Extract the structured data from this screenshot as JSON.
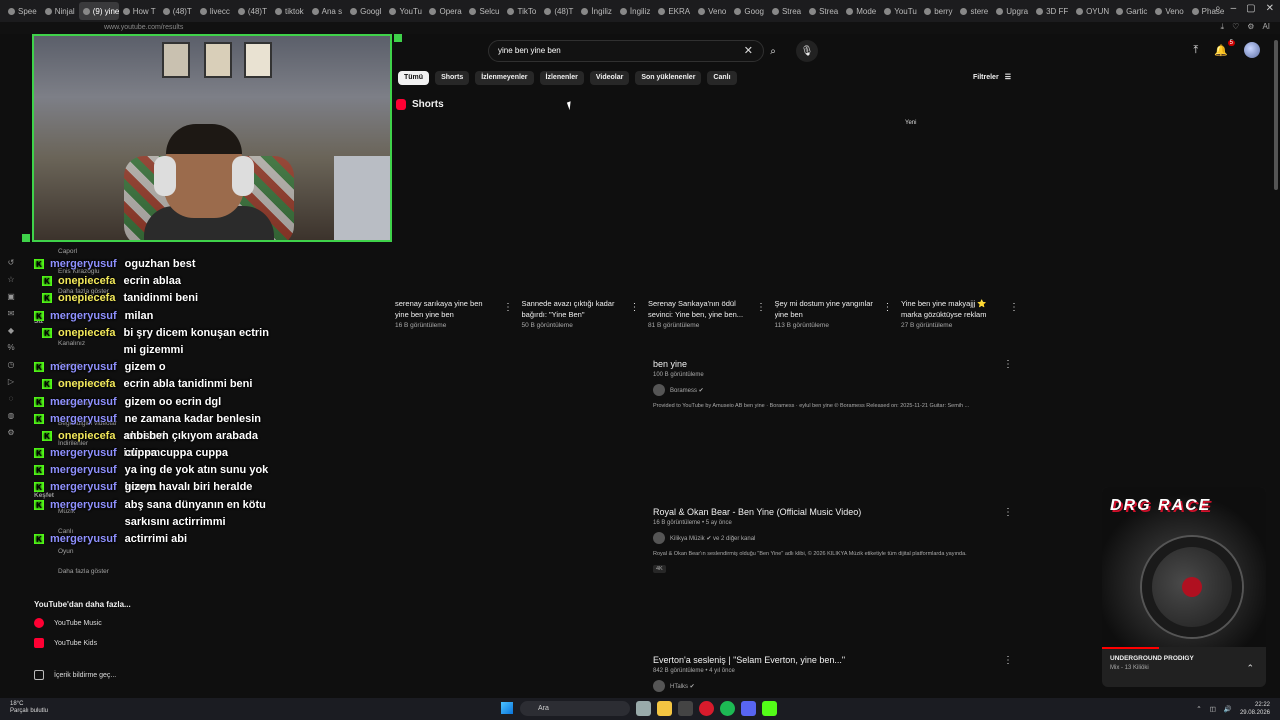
{
  "browser": {
    "tabs": [
      "Spee",
      "Ninjal",
      "(9) yine ben",
      "How T",
      "(48)T",
      "livecc",
      "(48)T",
      "tiktok",
      "Ana s",
      "Googl",
      "YouTu",
      "Opera",
      "Selcu",
      "TikTo",
      "(48)T",
      "İngiliz",
      "İngiliz",
      "EKRA",
      "Veno",
      "Goog",
      "Strea",
      "Strea",
      "Mode",
      "YouTu",
      "berry",
      "stere",
      "Upgra",
      "3D FF",
      "OYUN",
      "Gartic",
      "Veno",
      "Phase"
    ],
    "url": "www.youtube.com/results",
    "ai_label": "AI"
  },
  "search": {
    "query": "yine ben yine ben"
  },
  "chips": [
    "Tümü",
    "Shorts",
    "İzlenmeyenler",
    "İzlenenler",
    "Videolar",
    "Son yüklenenler",
    "Canlı"
  ],
  "filters_label": "Filtreler",
  "notifications_count": "5",
  "shorts": {
    "header": "Shorts",
    "new_label": "Yeni",
    "items": [
      {
        "title": "serenay sarıkaya yine ben yine ben yine ben",
        "views": "16 B görüntüleme"
      },
      {
        "title": "Sannede avazı çıktığı kadar bağırdı: \"Yine Ben\"",
        "views": "50 B görüntüleme"
      },
      {
        "title": "Serenay Sarıkaya'nın ödül sevinci: Yine ben, yine ben...",
        "views": "81 B görüntüleme"
      },
      {
        "title": "Şey mi dostum yine yangınlar yine ben",
        "views": "113 B görüntüleme"
      },
      {
        "title": "Yine ben yine makyajjj ⭐ marka gözüktüyse reklam",
        "views": "27 B görüntüleme"
      }
    ]
  },
  "videos": [
    {
      "title": "ben yine",
      "meta": "100 B görüntüleme",
      "channel": "Boramess ✔",
      "desc": "Provided to YouTube by Amuseio AB ben yine · Boramess · eylul ben yine ℗ Boramess Released on: 2025-11-21 Guitar: Semih ...",
      "tag": ""
    },
    {
      "title": "Royal & Okan Bear - Ben Yine (Official Music Video)",
      "meta": "16 B görüntüleme • 5 ay önce",
      "channel": "Kilikya Müzik ✔ ve 2 diğer kanal",
      "desc": "Royal & Okan Bear'ın seslendirmiş olduğu \"Ben Yine\" adlı klibi, © 2026 KİLİKYA Müzik etiketiyle tüm dijital platformlarda yayında.",
      "tag": "4K"
    },
    {
      "title": "Everton'a sesleniş | \"Selam Everton, yine ben...\"",
      "meta": "842 B görüntüleme • 4 yıl önce",
      "channel": "HTalks ✔",
      "desc": "",
      "tag": ""
    }
  ],
  "sidebar": {
    "ghost_items": [
      "Caporl",
      "Enis Kirazoglu",
      "Daha fazla göster",
      "Siz",
      "Kanalınız",
      "Geçmiş",
      "Oynatma listeleri",
      "Videolarınız",
      "Beğendiğim videolar",
      "İndirilenler",
      "Keşfet",
      "Müzik",
      "Canlı",
      "Oyun",
      "Daha fazla göster"
    ],
    "section_more": "YouTube'dan daha fazla...",
    "yt_music": "YouTube Music",
    "yt_kids": "YouTube Kids",
    "report": "İçerik bildirme geç..."
  },
  "chat": [
    {
      "user": "mergeryusuf",
      "text": "oguzhan best",
      "color": "#8f91ff"
    },
    {
      "user": "onepiecefa",
      "text": "ecrin ablaa",
      "color": "#f2e85a"
    },
    {
      "user": "onepiecefa",
      "text": "tanidinmi beni",
      "color": "#f2e85a"
    },
    {
      "user": "mergeryusuf",
      "text": "milan",
      "color": "#8f91ff"
    },
    {
      "user": "onepiecefa",
      "text": "bi şry dicem konuşan ectrin mi gizemmi",
      "color": "#f2e85a"
    },
    {
      "user": "mergeryusuf",
      "text": "gizem o",
      "color": "#8f91ff"
    },
    {
      "user": "onepiecefa",
      "text": "ecrin abla tanidinmi beni",
      "color": "#f2e85a"
    },
    {
      "user": "mergeryusuf",
      "text": "gizem oo ecrin dgl",
      "color": "#8f91ff"
    },
    {
      "user": "mergeryusuf",
      "text": "ne zamana kadar benlesin ekoshvl",
      "color": "#8f91ff"
    },
    {
      "user": "onepiecefa",
      "text": "anbi ben çıkıyom arabada izlicsm",
      "color": "#f2e85a"
    },
    {
      "user": "mergeryusuf",
      "text": "cuppa cuppa cuppa",
      "color": "#8f91ff"
    },
    {
      "user": "mergeryusuf",
      "text": "ya ing de yok atın sunu yok konya",
      "color": "#8f91ff"
    },
    {
      "user": "mergeryusuf",
      "text": "gizem havalı biri heralde",
      "color": "#8f91ff"
    },
    {
      "user": "mergeryusuf",
      "text": "abş sana dünyanın en kötu sarkısını actirrimmi",
      "color": "#8f91ff"
    },
    {
      "user": "mergeryusuf",
      "text": "actirrimi abi",
      "color": "#8f91ff"
    }
  ],
  "mini_player": {
    "art_text": "DRG RACE",
    "title": "UNDERGROUND PRODIGY",
    "subtitle": "Mix - 13 Kiliöki"
  },
  "taskbar": {
    "weather_temp": "18°C",
    "weather_desc": "Parçalı bulutlu",
    "search": "Ara",
    "time": "22:22",
    "date": "29.08.2026"
  }
}
